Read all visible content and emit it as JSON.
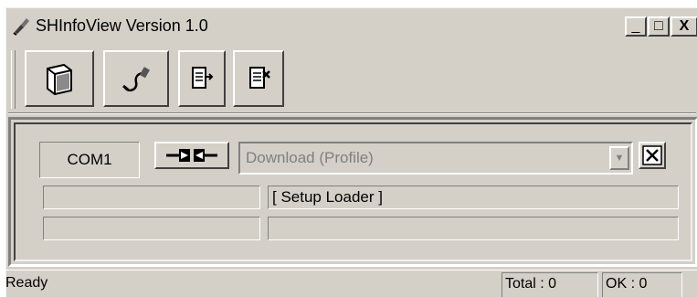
{
  "window": {
    "title": "SHInfoView Version 1.0",
    "caption_buttons": {
      "minimize": "_",
      "maximize": "□",
      "close": "X"
    }
  },
  "toolbar": {
    "buttons": [
      {
        "icon": "book-icon"
      },
      {
        "icon": "cable-icon"
      },
      {
        "icon": "export-icon"
      },
      {
        "icon": "import-icon"
      }
    ]
  },
  "main": {
    "port_label": "COM1",
    "connect_icon": "plug-connector-icon",
    "mode_select": {
      "selected": "Download (Profile)",
      "disabled": true
    },
    "cancel_icon": "close-x-icon",
    "status_rows": [
      {
        "left": "",
        "right": "[ Setup Loader ]"
      },
      {
        "left": "",
        "right": ""
      }
    ]
  },
  "statusbar": {
    "message": "Ready",
    "total": "Total : 0",
    "ok": "OK : 0"
  },
  "colors": {
    "face": "#d4d0c8",
    "shadow": "#808080",
    "dark_shadow": "#404040",
    "highlight": "#ffffff",
    "disabled_text": "#808080"
  }
}
